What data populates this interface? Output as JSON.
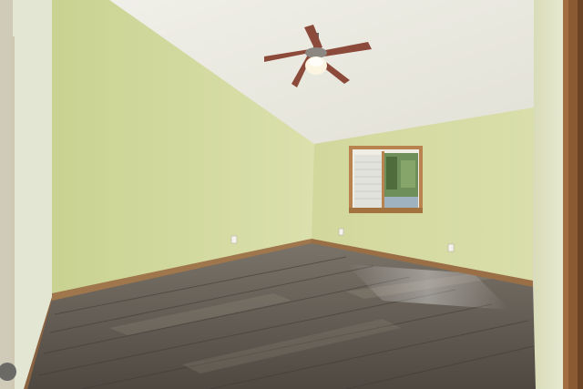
{
  "scene": {
    "colors": {
      "ceiling": "#e8e6dc",
      "left_wall": "#cfd79a",
      "back_wall": "#d6dca2",
      "right_wall": "#dee2bf",
      "floor": "#5f5a52",
      "baseboard": "#a0764c",
      "trim": "#b8834e",
      "door_frame": "#8a5a33",
      "fan_blade": "#8c4a3a",
      "window_glass": "#6e8f5a"
    },
    "objects": [
      "ceiling-fan",
      "window",
      "wall-outlet",
      "door-frame",
      "hardwood-floor"
    ]
  }
}
